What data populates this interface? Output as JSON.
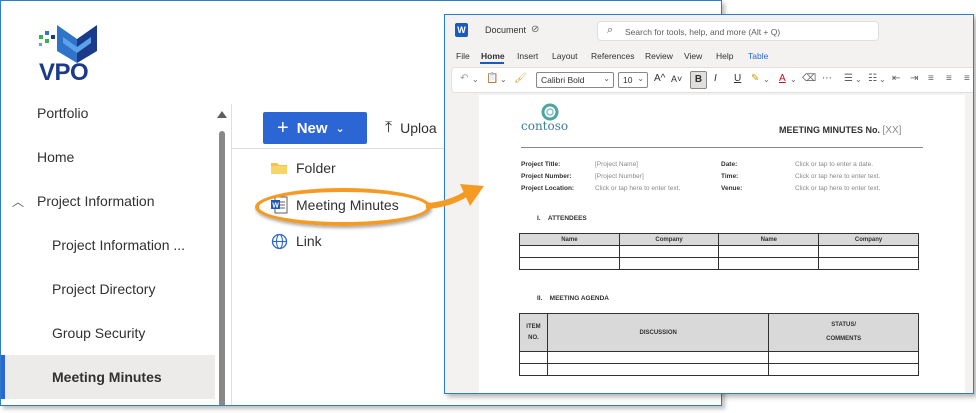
{
  "logo": {
    "text": "VPO"
  },
  "nav": {
    "items": [
      {
        "label": "Portfolio"
      },
      {
        "label": "Home"
      },
      {
        "label": "Project Information",
        "expanded": true
      },
      {
        "label": "Project Information ..."
      },
      {
        "label": "Project Directory"
      },
      {
        "label": "Group Security"
      },
      {
        "label": "Meeting Minutes",
        "active": true
      }
    ]
  },
  "toolbar": {
    "new_label": "New",
    "upload_label": "Uploa"
  },
  "new_menu": {
    "items": [
      {
        "label": "Folder",
        "icon": "folder-icon"
      },
      {
        "label": "Meeting Minutes",
        "icon": "word-doc-icon"
      },
      {
        "label": "Link",
        "icon": "globe-icon"
      }
    ]
  },
  "colors": {
    "accent": "#2c66d4",
    "highlight": "#f59a23",
    "word_blue": "#185abd"
  },
  "word": {
    "title_icon": "W",
    "doc_name": "Document",
    "search_placeholder": "Search for tools, help, and more (Alt + Q)",
    "menu": [
      "File",
      "Home",
      "Insert",
      "Layout",
      "References",
      "Review",
      "View",
      "Help",
      "Table"
    ],
    "active_menu": "Home",
    "font": "Calibri Bold",
    "font_size": "10",
    "ribbon": {
      "grow": "A^",
      "shrink": "A˅",
      "bold": "B",
      "italic": "I",
      "underline": "U",
      "font_color": "A"
    },
    "document": {
      "logo_text": "contoso",
      "title": "MEETING MINUTES No.",
      "title_num": "[XX]",
      "fields_left": [
        {
          "label": "Project Title:",
          "value": "[Project Name]"
        },
        {
          "label": "Project Number:",
          "value": "[Project Number]"
        },
        {
          "label": "Project Location:",
          "value": "Click or tap here to enter text."
        }
      ],
      "fields_right": [
        {
          "label": "Date:",
          "value": "Click or tap to enter a date."
        },
        {
          "label": "Time:",
          "value": "Click or tap here to enter text."
        },
        {
          "label": "Venue:",
          "value": "Click or tap here to enter text."
        }
      ],
      "section1": {
        "num": "I.",
        "title": "ATTENDEES"
      },
      "attendees_headers": [
        "Name",
        "Company",
        "Name",
        "Company"
      ],
      "section2": {
        "num": "II.",
        "title": "MEETING AGENDA"
      },
      "agenda_headers": {
        "item": "ITEM",
        "item2": "NO.",
        "discussion": "DISCUSSION",
        "status": "STATUS/",
        "status2": "COMMENTS"
      }
    }
  }
}
